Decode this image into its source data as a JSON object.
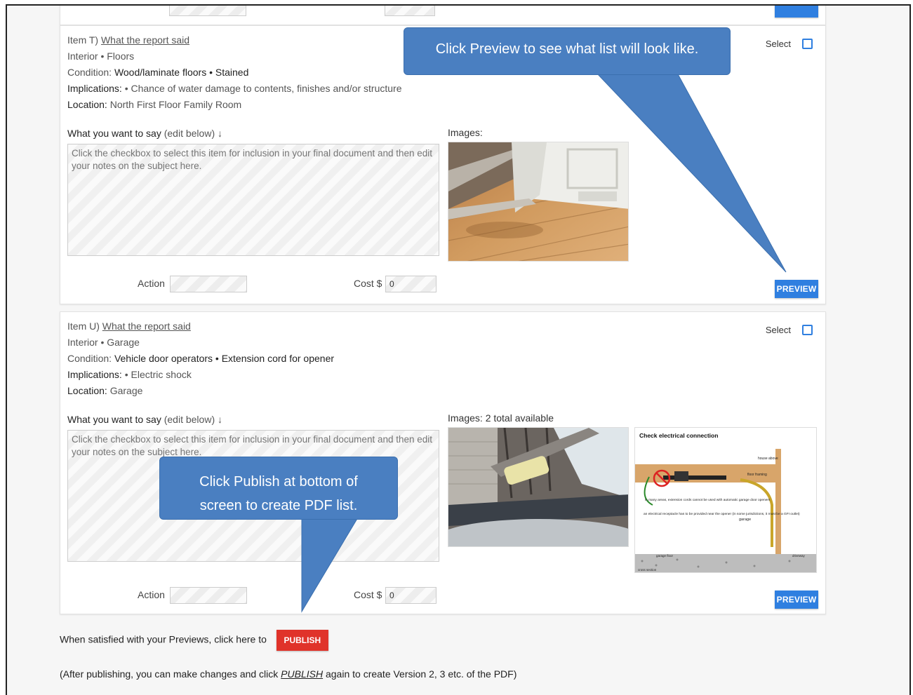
{
  "item_t": {
    "item_prefix": "Item T)",
    "report_link": "What the report said",
    "category": "Interior • Floors",
    "condition_label": "Condition:",
    "condition_value": "Wood/laminate floors • Stained",
    "implications_label": "Implications:",
    "implications_value": "• Chance of water damage to contents, finishes and/or structure",
    "location_label": "Location:",
    "location_value": "North First Floor Family Room",
    "say_label": "What you want to say",
    "say_hint": "(edit below) ↓",
    "notes_placeholder": "Click the checkbox to select this item for inclusion in your final document and then edit your notes on the subject here.",
    "images_label": "Images:",
    "select_label": "Select",
    "action_label": "Action",
    "cost_label": "Cost $",
    "cost_value": "0",
    "preview_label": "PREVIEW"
  },
  "item_u": {
    "item_prefix": "Item U)",
    "report_link": "What the report said",
    "category": "Interior • Garage",
    "condition_label": "Condition:",
    "condition_value": "Vehicle door operators • Extension cord for opener",
    "implications_label": "Implications:",
    "implications_value": "• Electric shock",
    "location_label": "Location:",
    "location_value": "Garage",
    "say_label": "What you want to say",
    "say_hint": "(edit below) ↓",
    "notes_placeholder": "Click the checkbox to select this item for inclusion in your final document and then edit your notes on the subject here.",
    "images_label": "Images: 2 total available",
    "select_label": "Select",
    "action_label": "Action",
    "cost_label": "Cost $",
    "cost_value": "0",
    "preview_label": "PREVIEW",
    "diagram": {
      "title": "Check electrical connection",
      "house_above": "house above",
      "floor_framing": "floor framing",
      "note_1": "in many areas, extension cords cannot be used with automatic garage door openers",
      "note_2": "an electrical receptacle has to be provided near the opener (in some jurisdictions, it must be a GFI outlet)",
      "garage": "garage",
      "garage_floor": "garage floor",
      "driveway": "driveway",
      "section": "cross section"
    }
  },
  "footer": {
    "publish_prompt": "When satisfied with your Previews, click here to",
    "publish_label": "PUBLISH",
    "after_prefix": "(After publishing, you can make changes and click ",
    "after_link": "PUBLISH",
    "after_suffix": " again to create Version 2, 3 etc. of the PDF)"
  },
  "callouts": {
    "preview_tip": "Click Preview to see what list will look like.",
    "publish_tip": "Click Publish at bottom of screen to create PDF list."
  },
  "colors": {
    "accent_blue": "#2f7fe0",
    "publish_red": "#e0332a",
    "callout_blue": "#4a7fc1"
  }
}
